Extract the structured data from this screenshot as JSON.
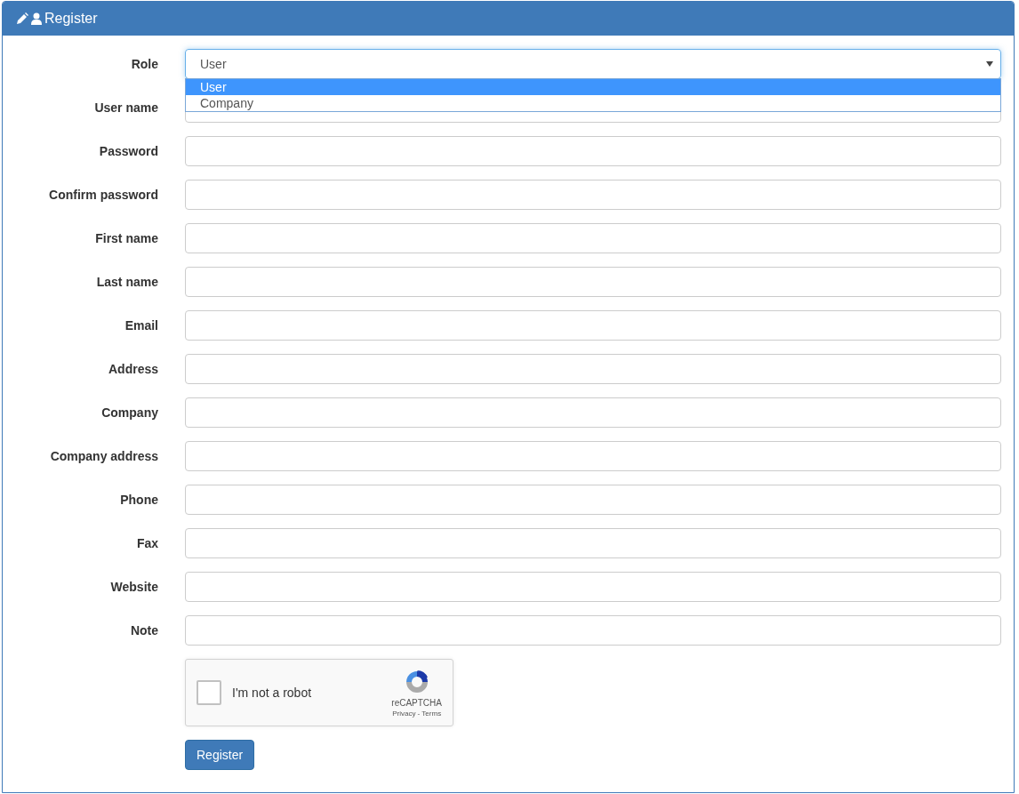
{
  "panel": {
    "title": "Register"
  },
  "role": {
    "label": "Role",
    "value": "User",
    "expanded": true,
    "options": [
      {
        "label": "User",
        "selected": true
      },
      {
        "label": "Company",
        "selected": false
      }
    ]
  },
  "fields": [
    {
      "label": "User name"
    },
    {
      "label": "Password"
    },
    {
      "label": "Confirm password"
    },
    {
      "label": "First name"
    },
    {
      "label": "Last name"
    },
    {
      "label": "Email"
    },
    {
      "label": "Address"
    },
    {
      "label": "Company"
    },
    {
      "label": "Company address"
    },
    {
      "label": "Phone"
    },
    {
      "label": "Fax"
    },
    {
      "label": "Website"
    },
    {
      "label": "Note"
    }
  ],
  "captcha": {
    "label": "I'm not a robot",
    "checked": false,
    "brand": "reCAPTCHA",
    "links": "Privacy - Terms"
  },
  "submit": {
    "label": "Register"
  }
}
